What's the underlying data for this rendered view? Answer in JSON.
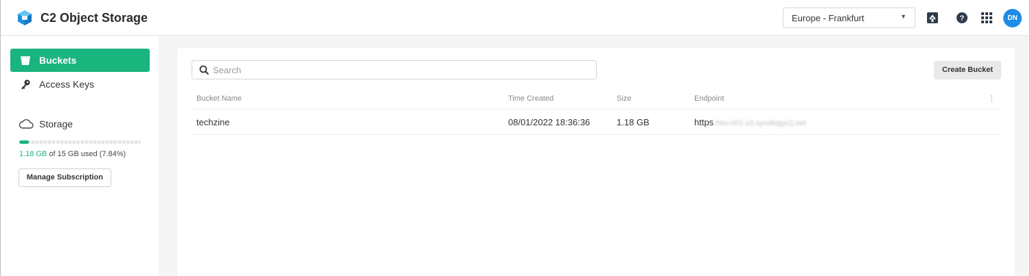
{
  "app": {
    "title": "C2 Object Storage",
    "logo_icon": "cube-logo-icon",
    "accent": "#1ab47e"
  },
  "header": {
    "region": {
      "selected": "Europe - Frankfurt"
    },
    "icons": [
      "dashboard-icon",
      "help-icon",
      "apps-grid-icon"
    ],
    "avatar": "DN"
  },
  "sidebar": {
    "items": [
      {
        "label": "Buckets",
        "icon": "bucket-icon",
        "active": true
      },
      {
        "label": "Access Keys",
        "icon": "key-icon",
        "active": false
      }
    ],
    "storage": {
      "label": "Storage",
      "icon": "cloud-icon",
      "used": "1.18 GB",
      "usage_suffix": " of 15 GB used (7.84%)",
      "percent": 7.84,
      "manage_label": "Manage Subscription"
    }
  },
  "main": {
    "search_placeholder": "Search",
    "create_label": "Create Bucket",
    "columns": [
      "Bucket Name",
      "Time Created",
      "Size",
      "Endpoint"
    ],
    "rows": [
      {
        "name": "techzine",
        "time": "08/01/2022 18:36:36",
        "size": "1.18 GB",
        "endpoint_prefix": "https",
        "endpoint_blurred": "://eu-001.s3.synologyc2.net"
      }
    ]
  }
}
